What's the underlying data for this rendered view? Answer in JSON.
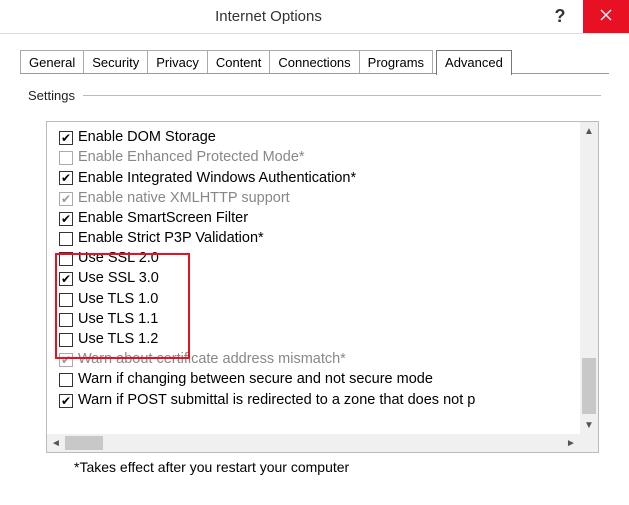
{
  "window": {
    "title": "Internet Options"
  },
  "tabs": {
    "items": [
      {
        "label": "General"
      },
      {
        "label": "Security"
      },
      {
        "label": "Privacy"
      },
      {
        "label": "Content"
      },
      {
        "label": "Connections"
      },
      {
        "label": "Programs"
      },
      {
        "label": "Advanced"
      }
    ],
    "active": 6
  },
  "group": {
    "label": "Settings"
  },
  "settings": {
    "items": [
      {
        "label": "Enable DOM Storage",
        "checked": true,
        "disabled": false
      },
      {
        "label": "Enable Enhanced Protected Mode*",
        "checked": false,
        "disabled": true
      },
      {
        "label": "Enable Integrated Windows Authentication*",
        "checked": true,
        "disabled": false
      },
      {
        "label": "Enable native XMLHTTP support",
        "checked": true,
        "disabled": true
      },
      {
        "label": "Enable SmartScreen Filter",
        "checked": true,
        "disabled": false
      },
      {
        "label": "Enable Strict P3P Validation*",
        "checked": false,
        "disabled": false
      },
      {
        "label": "Use SSL 2.0",
        "checked": false,
        "disabled": false
      },
      {
        "label": "Use SSL 3.0",
        "checked": true,
        "disabled": false
      },
      {
        "label": "Use TLS 1.0",
        "checked": false,
        "disabled": false
      },
      {
        "label": "Use TLS 1.1",
        "checked": false,
        "disabled": false
      },
      {
        "label": "Use TLS 1.2",
        "checked": false,
        "disabled": false
      },
      {
        "label": "Warn about certificate address mismatch*",
        "checked": true,
        "disabled": true
      },
      {
        "label": "Warn if changing between secure and not secure mode",
        "checked": false,
        "disabled": false
      },
      {
        "label": "Warn if POST submittal is redirected to a zone that does not p",
        "checked": true,
        "disabled": false
      }
    ]
  },
  "footnote": "*Takes effect after you restart your computer"
}
